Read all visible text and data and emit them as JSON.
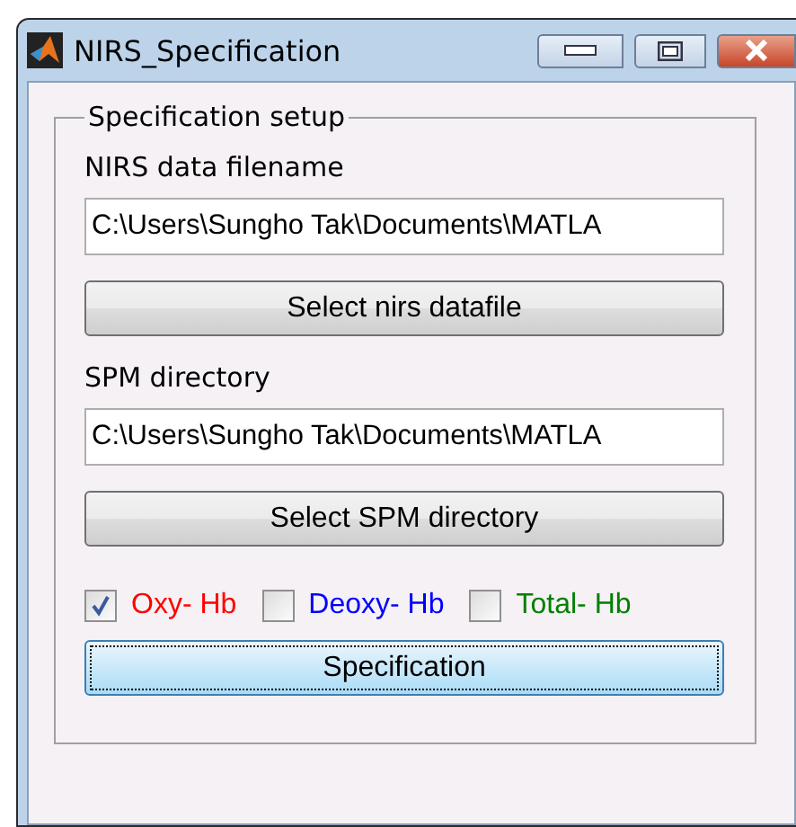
{
  "window": {
    "title": "NIRS_Specification"
  },
  "group": {
    "title": "Specification setup"
  },
  "fields": [
    {
      "label": "NIRS data filename",
      "value": "C:\\Users\\Sungho Tak\\Documents\\MATLA",
      "button": "Select nirs datafile"
    },
    {
      "label": "SPM directory",
      "value": "C:\\Users\\Sungho Tak\\Documents\\MATLA",
      "button": "Select SPM directory"
    }
  ],
  "checkboxes": [
    {
      "label": "Oxy- Hb",
      "checked": true,
      "color": "#ff0000"
    },
    {
      "label": "Deoxy- Hb",
      "checked": false,
      "color": "#0000ff"
    },
    {
      "label": "Total- Hb",
      "checked": false,
      "color": "#008000"
    }
  ],
  "action_button": {
    "label": "Specification"
  }
}
